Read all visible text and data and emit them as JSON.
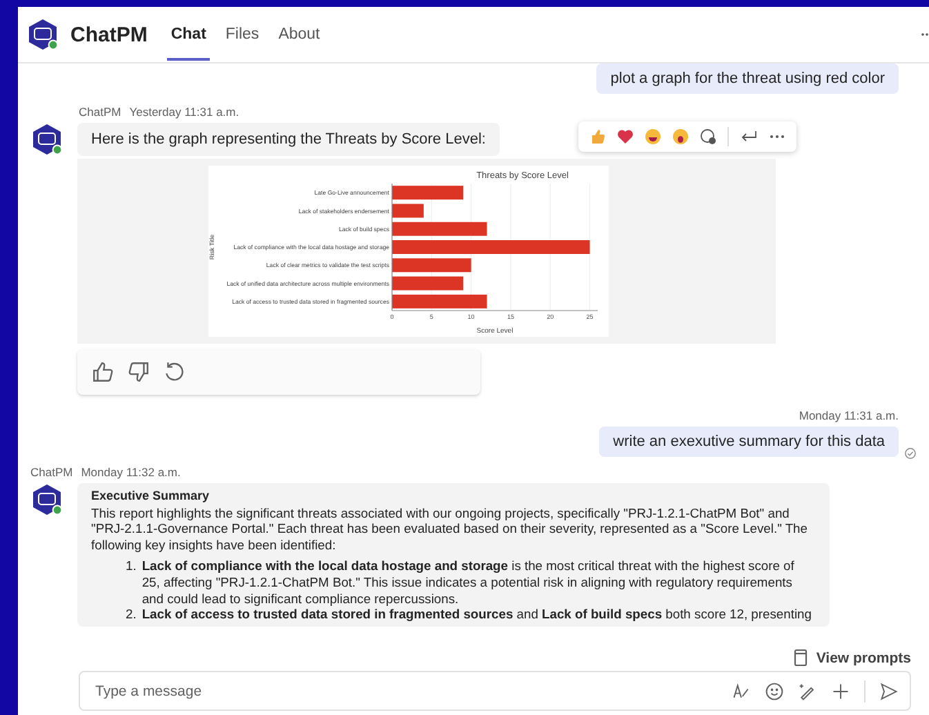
{
  "app": {
    "name": "ChatPM",
    "tabs": [
      {
        "label": "Chat",
        "selected": true
      },
      {
        "label": "Files",
        "selected": false
      },
      {
        "label": "About",
        "selected": false
      }
    ]
  },
  "messages": [
    {
      "kind": "user",
      "text": "plot a graph for the threat using red color"
    },
    {
      "kind": "bot-chart",
      "sender": "ChatPM",
      "time": "Yesterday 11:31 a.m.",
      "text": "Here is the graph representing the Threats by Score Level:",
      "chart_data": {
        "type": "bar",
        "orientation": "horizontal",
        "title": "Threats by Score Level",
        "xlabel": "Score Level",
        "ylabel": "Risk Title",
        "categories": [
          "Late Go-Live announcement",
          "Lack of stakeholders endersement",
          "Lack of build specs",
          "Lack of compliance with the local data hostage and storage",
          "Lack of clear metrics to validate the test scripts",
          "Lack of unified data architecture across multiple environments",
          "Lack of access to trusted data stored in fragmented sources"
        ],
        "series": [
          {
            "color": "#dc3526",
            "values": [
              9,
              4,
              12,
              25,
              10,
              9,
              12
            ]
          }
        ],
        "grid": true,
        "xlim": [
          0,
          26
        ],
        "xticks": [
          0,
          5,
          10,
          15,
          20,
          25
        ]
      }
    },
    {
      "kind": "user",
      "time": "Monday 11:31 a.m.",
      "text": "write an exexutive summary for this data"
    },
    {
      "kind": "bot-summary",
      "sender": "ChatPM",
      "time": "Monday 11:32 a.m.",
      "heading": "Executive Summary",
      "intro": "This report highlights the significant threats associated with our ongoing projects, specifically \"PRJ-1.2.1-ChatPM Bot\" and \"PRJ-2.1.1-Governance Portal.\" Each threat has been evaluated based on their severity, represented as a \"Score Level.\" The following key insights have been identified:",
      "items": [
        {
          "number": "1.",
          "text": "**Lack of compliance with the local data hostage and storage** is the most critical threat with the highest score of 25, affecting \"PRJ-1.2.1-ChatPM Bot.\" This issue indicates a potential risk in aligning with regulatory requirements and could lead to significant compliance repercussions."
        },
        {
          "number": "2.",
          "text": "**Lack of access to trusted data stored in fragmented sources** and **Lack of build specs** both score 12, presenting"
        }
      ]
    }
  ],
  "view_prompts": "View prompts",
  "composer": {
    "placeholder": "Type a message"
  }
}
